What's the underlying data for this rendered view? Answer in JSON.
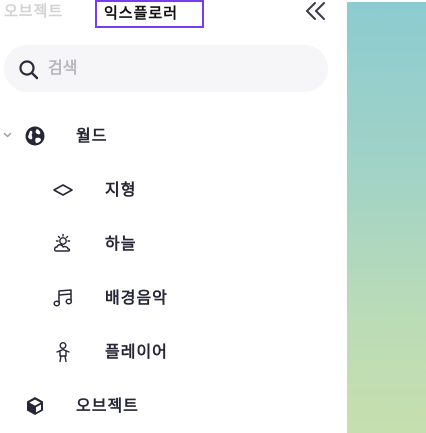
{
  "tabs": {
    "objects_label": "오브젝트",
    "explorer_label": "익스플로러"
  },
  "search": {
    "placeholder": "검색"
  },
  "tree": {
    "world": {
      "label": "월드"
    },
    "terrain": {
      "label": "지형"
    },
    "sky": {
      "label": "하늘"
    },
    "bgm": {
      "label": "배경음악"
    },
    "player": {
      "label": "플레이어"
    },
    "objects": {
      "label": "오브젝트"
    }
  },
  "colors": {
    "selected_tab_outline": "#7a3cf0",
    "text_dark": "#262637",
    "text_muted": "#d3d3d6",
    "search_bg": "#f6f6f8",
    "preview_panel_top": "#8ccbd0",
    "preview_panel_bottom": "#c6dfae"
  },
  "icons": {
    "collapse": "double-chevron-left-icon",
    "search": "magnifier-icon",
    "world": "globe-icon",
    "terrain": "diamond-outline-icon",
    "sky": "sun-cloud-icon",
    "bgm": "music-notes-icon",
    "player": "person-icon",
    "objects": "cube-icon"
  }
}
